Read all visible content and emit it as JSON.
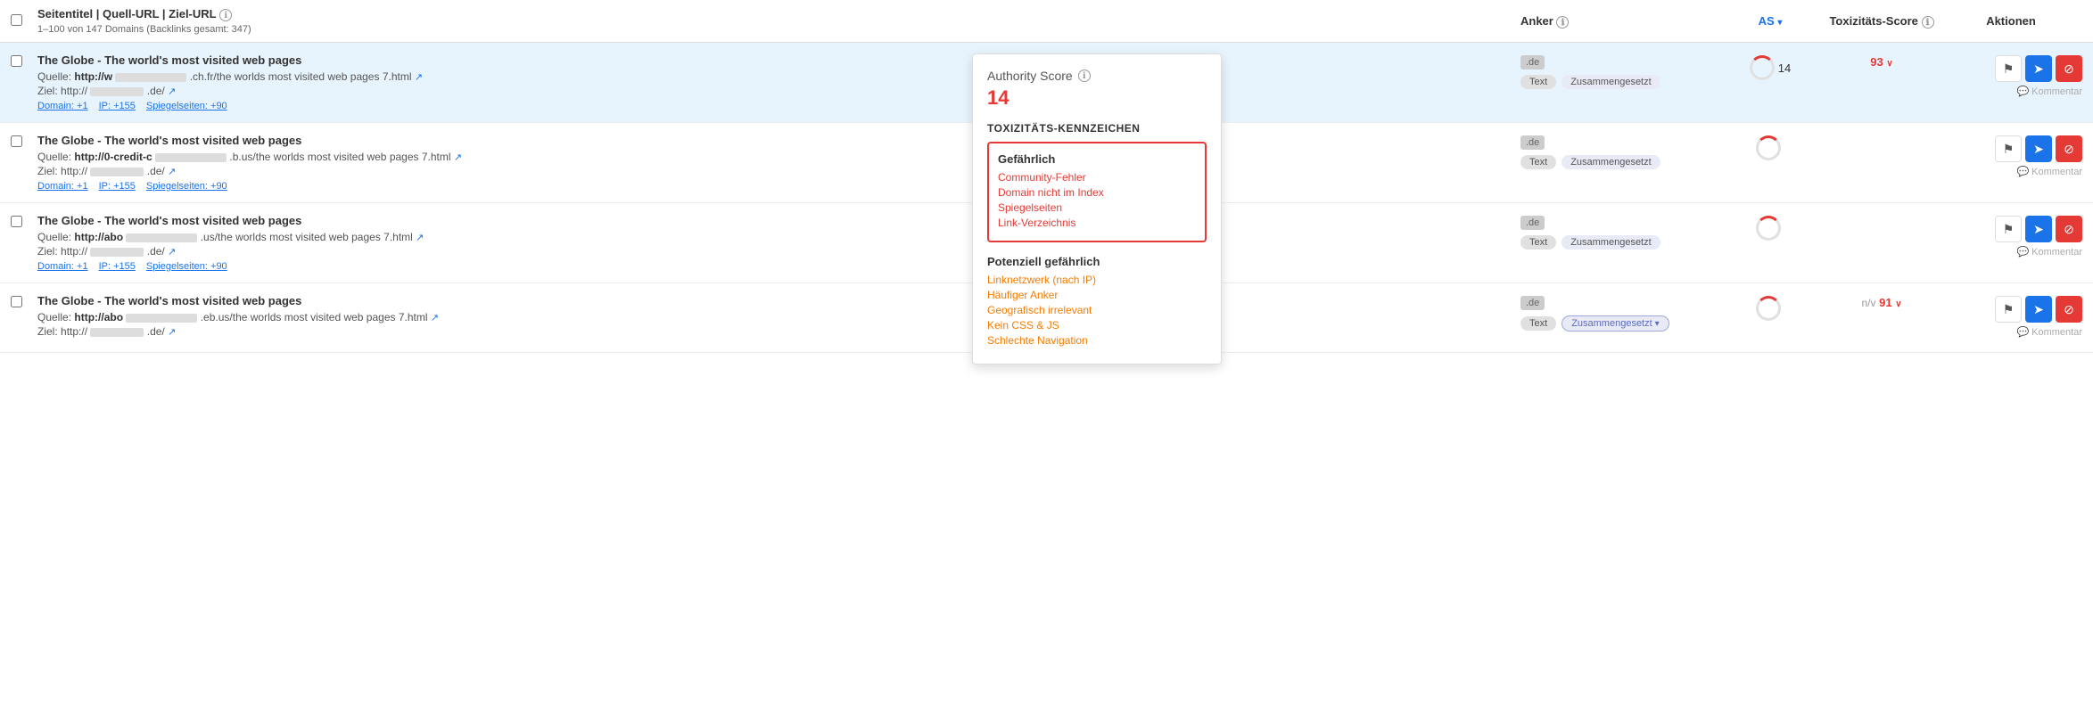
{
  "header": {
    "title": "Seitentitel | Quell-URL | Ziel-URL",
    "info_icon": "ℹ",
    "subtitle": "1–100 von 147 Domains (Backlinks gesamt: 347)",
    "col_anker": "Anker",
    "col_as": "AS",
    "col_toxizitat": "Toxizitäts-Score",
    "col_aktionen": "Aktionen"
  },
  "rows": [
    {
      "id": 1,
      "highlighted": true,
      "title": "The Globe - The world's most visited web pages",
      "source_label": "Quelle:",
      "source_prefix": "http://w",
      "source_domain": ".ch.fr/the worlds most visited web pages 7.html",
      "target_label": "Ziel:",
      "target_url": "http://",
      "target_domain": ".de/",
      "links": [
        "Domain: +1",
        "IP: +155",
        "Spiegelseiten: +90"
      ],
      "anker_domain": ".de",
      "badge1": "Text",
      "badge2": "Zusammengesetzt",
      "badge2_active": false,
      "as_value": "14",
      "toxizitat": "93",
      "toxizitat_chevron": "∨"
    },
    {
      "id": 2,
      "highlighted": false,
      "title": "The Globe - The world's most visited web pages",
      "source_label": "Quelle:",
      "source_prefix": "http://0-credit-c",
      "source_domain": ".b.us/the worlds most visited web pages 7.html",
      "target_label": "Ziel:",
      "target_url": "http://",
      "target_domain": ".de/",
      "links": [
        "Domain: +1",
        "IP: +155",
        "Spiegelseiten: +90"
      ],
      "anker_domain": ".de",
      "badge1": "Text",
      "badge2": "Zusammengesetzt",
      "badge2_active": false,
      "as_value": "",
      "toxizitat": "",
      "toxizitat_chevron": ""
    },
    {
      "id": 3,
      "highlighted": false,
      "title": "The Globe - The world's most visited web pages",
      "source_label": "Quelle:",
      "source_prefix": "http://abo",
      "source_domain": ".us/the worlds most visited web pages 7.html",
      "target_label": "Ziel:",
      "target_url": "http://",
      "target_domain": ".de/",
      "links": [
        "Domain: +1",
        "IP: +155",
        "Spiegelseiten: +90"
      ],
      "anker_domain": ".de",
      "badge1": "Text",
      "badge2": "Zusammengesetzt",
      "badge2_active": false,
      "as_value": "",
      "toxizitat": "",
      "toxizitat_chevron": ""
    },
    {
      "id": 4,
      "highlighted": false,
      "title": "The Globe - The world's most visited web pages",
      "source_label": "Quelle:",
      "source_prefix": "http://abo",
      "source_domain": ".eb.us/the worlds most visited web pages 7.html",
      "target_label": "Ziel:",
      "target_url": "http://",
      "target_domain": ".de/",
      "links": [],
      "anker_domain": ".de",
      "badge1": "Text",
      "badge2": "Zusammengesetzt",
      "badge2_active": true,
      "as_value": "",
      "toxizitat": "91",
      "toxizitat_chevron": "∨",
      "toxizitat_prefix": "n/v"
    }
  ],
  "tooltip": {
    "title": "Authority Score",
    "info_icon": "ℹ",
    "score": "14",
    "section_toxizitat": "TOXIZITÄTS-KENNZEICHEN",
    "danger_label": "Gefährlich",
    "danger_items": [
      "Community-Fehler",
      "Domain nicht im Index",
      "Spiegelseiten",
      "Link-Verzeichnis"
    ],
    "warning_label": "Potenziell gefährlich",
    "warning_items": [
      "Linknetzwerk (nach IP)",
      "Häufiger Anker",
      "Geografisch irrelevant",
      "Kein CSS & JS",
      "Schlechte Navigation"
    ]
  },
  "icons": {
    "external_link": "↗",
    "send": "➤",
    "block": "⊘",
    "flag": "⚑",
    "comment": "💬",
    "chevron_down": "▾",
    "chevron_up": "▴"
  }
}
